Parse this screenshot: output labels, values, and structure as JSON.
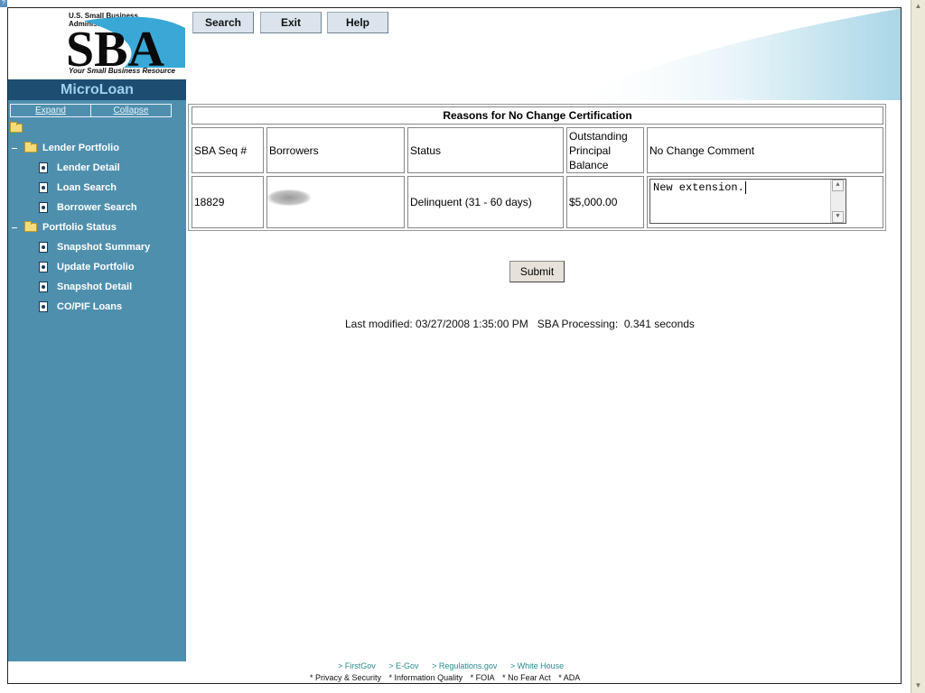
{
  "logo": {
    "agency": "U.S. Small Business Administration",
    "wordmark": "SBA",
    "tagline": "Your Small Business Resource"
  },
  "app_title": "MicroLoan",
  "tree_controls": {
    "expand": "Expand",
    "collapse": "Collapse"
  },
  "nav": {
    "lender_portfolio": "Lender Portfolio",
    "lender_detail": "Lender Detail",
    "loan_search": "Loan Search",
    "borrower_search": "Borrower Search",
    "portfolio_status": "Portfolio Status",
    "snapshot_summary": "Snapshot Summary",
    "update_portfolio": "Update Portfolio",
    "snapshot_detail": "Snapshot Detail",
    "co_pif_loans": "CO/PIF Loans"
  },
  "header_buttons": {
    "search": "Search",
    "exit": "Exit",
    "help": "Help"
  },
  "table": {
    "title": "Reasons for No Change Certification",
    "columns": {
      "seq": "SBA Seq #",
      "borrowers": "Borrowers",
      "status": "Status",
      "balance_l1": "Outstanding",
      "balance_l2": "Principal",
      "balance_l3": "Balance",
      "comment": "No Change Comment"
    },
    "row": {
      "seq": "18829",
      "borrower": "",
      "status": "Delinquent (31 - 60 days)",
      "balance": "$5,000.00",
      "comment": "New extension."
    }
  },
  "submit_label": "Submit",
  "last_modified": "Last modified: 03/27/2008 1:35:00 PM   SBA Processing:  0.341 seconds",
  "footer": {
    "links": [
      "> FirstGov",
      "> E-Gov",
      "> Regulations.gov",
      "> White House"
    ],
    "legal": [
      "* Privacy & Security",
      "* Information Quality",
      "* FOIA",
      "* No Fear Act",
      "* ADA"
    ]
  },
  "colors": {
    "sidebar": "#4f8fae",
    "title_bar": "#1d4e72",
    "accent_text": "#9fd0ee"
  }
}
